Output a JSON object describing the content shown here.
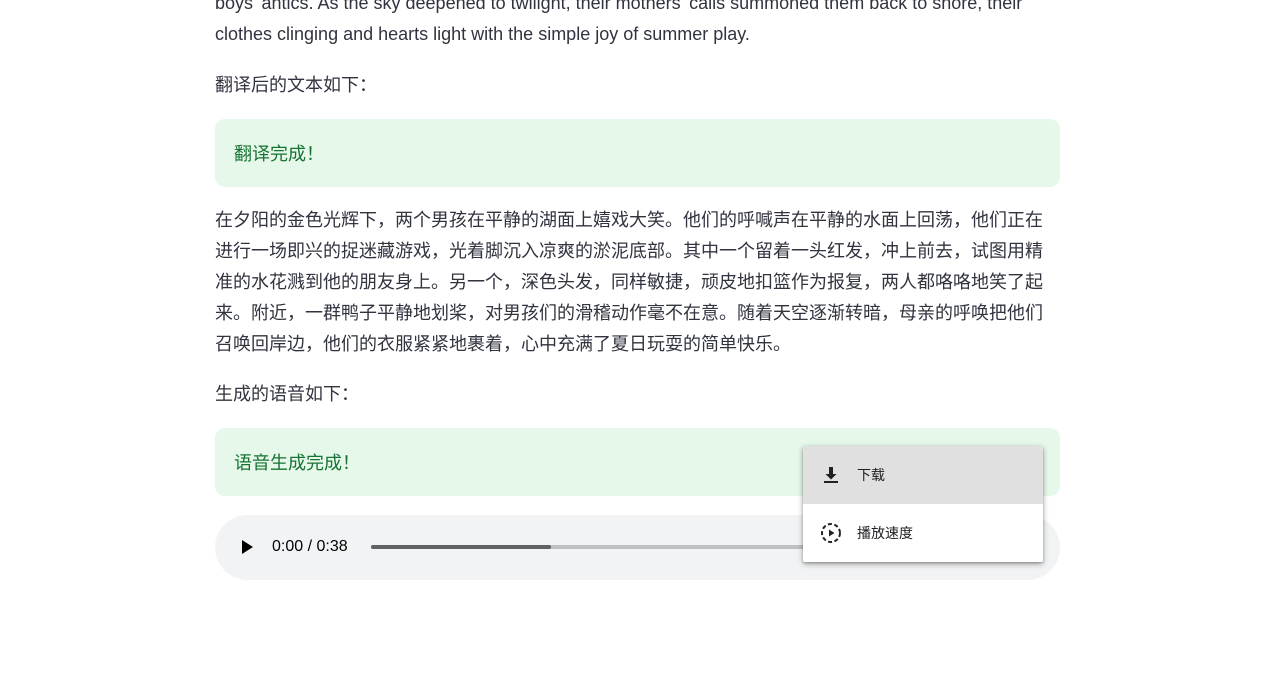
{
  "english_text": "boys' antics. As the sky deepened to twilight, their mothers' calls summoned them back to shore, their clothes clinging and hearts light with the simple joy of summer play.",
  "translation_label": "翻译后的文本如下：",
  "translation_alert": "翻译完成！",
  "translated_text": "在夕阳的金色光辉下，两个男孩在平静的湖面上嬉戏大笑。他们的呼喊声在平静的水面上回荡，他们正在进行一场即兴的捉迷藏游戏，光着脚沉入凉爽的淤泥底部。其中一个留着一头红发，冲上前去，试图用精准的水花溅到他的朋友身上。另一个，深色头发，同样敏捷，顽皮地扣篮作为报复，两人都咯咯地笑了起来。附近，一群鸭子平静地划桨，对男孩们的滑稽动作毫不在意。随着天空逐渐转暗，母亲的呼唤把他们召唤回岸边，他们的衣服紧紧地裹着，心中充满了夏日玩耍的简单快乐。",
  "speech_label": "生成的语音如下：",
  "speech_alert": "语音生成完成！",
  "audio": {
    "time": "0:00 / 0:38",
    "progress_fraction": 0.29
  },
  "menu": {
    "download_label": "下载",
    "speed_label": "播放速度",
    "download_icon": "download-icon",
    "speed_icon": "playback-speed-icon"
  },
  "colors": {
    "success_bg": "#e6f8ea",
    "success_text": "#177233",
    "audio_bg": "#f1f3f4"
  }
}
